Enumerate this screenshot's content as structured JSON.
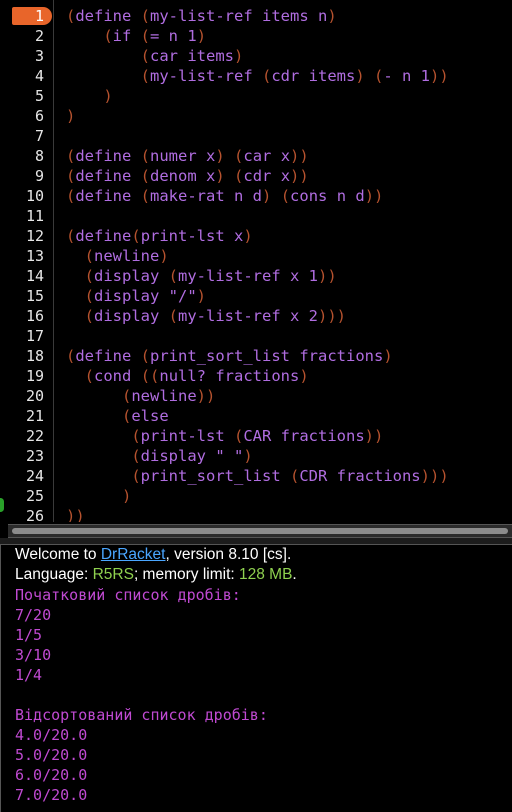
{
  "editor": {
    "current_line": "1",
    "line_numbers": [
      "1",
      "2",
      "3",
      "4",
      "5",
      "6",
      "7",
      "8",
      "9",
      "10",
      "11",
      "12",
      "13",
      "14",
      "15",
      "16",
      "17",
      "18",
      "19",
      "20",
      "21",
      "22",
      "23",
      "24",
      "25",
      "26"
    ],
    "code_lines": [
      [
        {
          "t": "(",
          "p": 1
        },
        {
          "t": "define "
        },
        {
          "t": "(",
          "p": 1
        },
        {
          "t": "my-list-ref items n"
        },
        {
          "t": ")",
          "p": 1
        }
      ],
      [
        {
          "t": "    "
        },
        {
          "t": "(",
          "p": 1
        },
        {
          "t": "if "
        },
        {
          "t": "(",
          "p": 1
        },
        {
          "t": "= n 1"
        },
        {
          "t": ")",
          "p": 1
        }
      ],
      [
        {
          "t": "        "
        },
        {
          "t": "(",
          "p": 1
        },
        {
          "t": "car items"
        },
        {
          "t": ")",
          "p": 1
        }
      ],
      [
        {
          "t": "        "
        },
        {
          "t": "(",
          "p": 1
        },
        {
          "t": "my-list-ref "
        },
        {
          "t": "(",
          "p": 1
        },
        {
          "t": "cdr items"
        },
        {
          "t": ")",
          "p": 1
        },
        {
          "t": " "
        },
        {
          "t": "(",
          "p": 1
        },
        {
          "t": "- n 1"
        },
        {
          "t": "))",
          "p": 1
        }
      ],
      [
        {
          "t": "    "
        },
        {
          "t": ")",
          "p": 1
        }
      ],
      [
        {
          "t": ")",
          "p": 1
        }
      ],
      [],
      [
        {
          "t": "(",
          "p": 1
        },
        {
          "t": "define "
        },
        {
          "t": "(",
          "p": 1
        },
        {
          "t": "numer x"
        },
        {
          "t": ")",
          "p": 1
        },
        {
          "t": " "
        },
        {
          "t": "(",
          "p": 1
        },
        {
          "t": "car x"
        },
        {
          "t": "))",
          "p": 1
        }
      ],
      [
        {
          "t": "(",
          "p": 1
        },
        {
          "t": "define "
        },
        {
          "t": "(",
          "p": 1
        },
        {
          "t": "denom x"
        },
        {
          "t": ")",
          "p": 1
        },
        {
          "t": " "
        },
        {
          "t": "(",
          "p": 1
        },
        {
          "t": "cdr x"
        },
        {
          "t": "))",
          "p": 1
        }
      ],
      [
        {
          "t": "(",
          "p": 1
        },
        {
          "t": "define "
        },
        {
          "t": "(",
          "p": 1
        },
        {
          "t": "make-rat n d"
        },
        {
          "t": ")",
          "p": 1
        },
        {
          "t": " "
        },
        {
          "t": "(",
          "p": 1
        },
        {
          "t": "cons n d"
        },
        {
          "t": "))",
          "p": 1
        }
      ],
      [],
      [
        {
          "t": "(",
          "p": 1
        },
        {
          "t": "define"
        },
        {
          "t": "(",
          "p": 1
        },
        {
          "t": "print-lst x"
        },
        {
          "t": ")",
          "p": 1
        }
      ],
      [
        {
          "t": "  "
        },
        {
          "t": "(",
          "p": 1
        },
        {
          "t": "newline"
        },
        {
          "t": ")",
          "p": 1
        }
      ],
      [
        {
          "t": "  "
        },
        {
          "t": "(",
          "p": 1
        },
        {
          "t": "display "
        },
        {
          "t": "(",
          "p": 1
        },
        {
          "t": "my-list-ref x 1"
        },
        {
          "t": "))",
          "p": 1
        }
      ],
      [
        {
          "t": "  "
        },
        {
          "t": "(",
          "p": 1
        },
        {
          "t": "display \"/\""
        },
        {
          "t": ")",
          "p": 1
        }
      ],
      [
        {
          "t": "  "
        },
        {
          "t": "(",
          "p": 1
        },
        {
          "t": "display "
        },
        {
          "t": "(",
          "p": 1
        },
        {
          "t": "my-list-ref x 2"
        },
        {
          "t": ")))",
          "p": 1
        }
      ],
      [],
      [
        {
          "t": "(",
          "p": 1
        },
        {
          "t": "define "
        },
        {
          "t": "(",
          "p": 1
        },
        {
          "t": "print_sort_list fractions"
        },
        {
          "t": ")",
          "p": 1
        }
      ],
      [
        {
          "t": "  "
        },
        {
          "t": "(",
          "p": 1
        },
        {
          "t": "cond "
        },
        {
          "t": "((",
          "p": 1
        },
        {
          "t": "null? fractions"
        },
        {
          "t": ")",
          "p": 1
        }
      ],
      [
        {
          "t": "      "
        },
        {
          "t": "(",
          "p": 1
        },
        {
          "t": "newline"
        },
        {
          "t": "))",
          "p": 1
        }
      ],
      [
        {
          "t": "      "
        },
        {
          "t": "(",
          "p": 1
        },
        {
          "t": "else"
        }
      ],
      [
        {
          "t": "       "
        },
        {
          "t": "(",
          "p": 1
        },
        {
          "t": "print-lst "
        },
        {
          "t": "(",
          "p": 1
        },
        {
          "t": "CAR fractions"
        },
        {
          "t": "))",
          "p": 1
        }
      ],
      [
        {
          "t": "       "
        },
        {
          "t": "(",
          "p": 1
        },
        {
          "t": "display \" \""
        },
        {
          "t": ")",
          "p": 1
        }
      ],
      [
        {
          "t": "       "
        },
        {
          "t": "(",
          "p": 1
        },
        {
          "t": "print_sort_list "
        },
        {
          "t": "(",
          "p": 1
        },
        {
          "t": "CDR fractions"
        },
        {
          "t": ")))",
          "p": 1
        }
      ],
      [
        {
          "t": "      "
        },
        {
          "t": ")",
          "p": 1
        }
      ],
      [
        {
          "t": "))",
          "p": 1
        }
      ]
    ]
  },
  "repl": {
    "welcome_prefix": "Welcome to ",
    "welcome_link": "DrRacket",
    "welcome_suffix": ", version 8.10 [cs].",
    "language_prefix": "Language: ",
    "language_name": "R5RS",
    "language_mid": "; memory limit: ",
    "memory_limit": "128 MB",
    "language_suffix": ".",
    "output_lines": [
      "Початковий список дробів:",
      "7/20",
      "1/5",
      "3/10",
      "1/4",
      "",
      "Відсортований список дробів:",
      "4.0/20.0",
      "5.0/20.0",
      "6.0/20.0",
      "7.0/20.0"
    ]
  },
  "colors": {
    "keyword": "#b06de0",
    "paren": "#b5522e",
    "output": "#c04ad2",
    "link": "#4aa6ff",
    "language": "#8fd14f",
    "current_line_marker": "#e8652a"
  }
}
